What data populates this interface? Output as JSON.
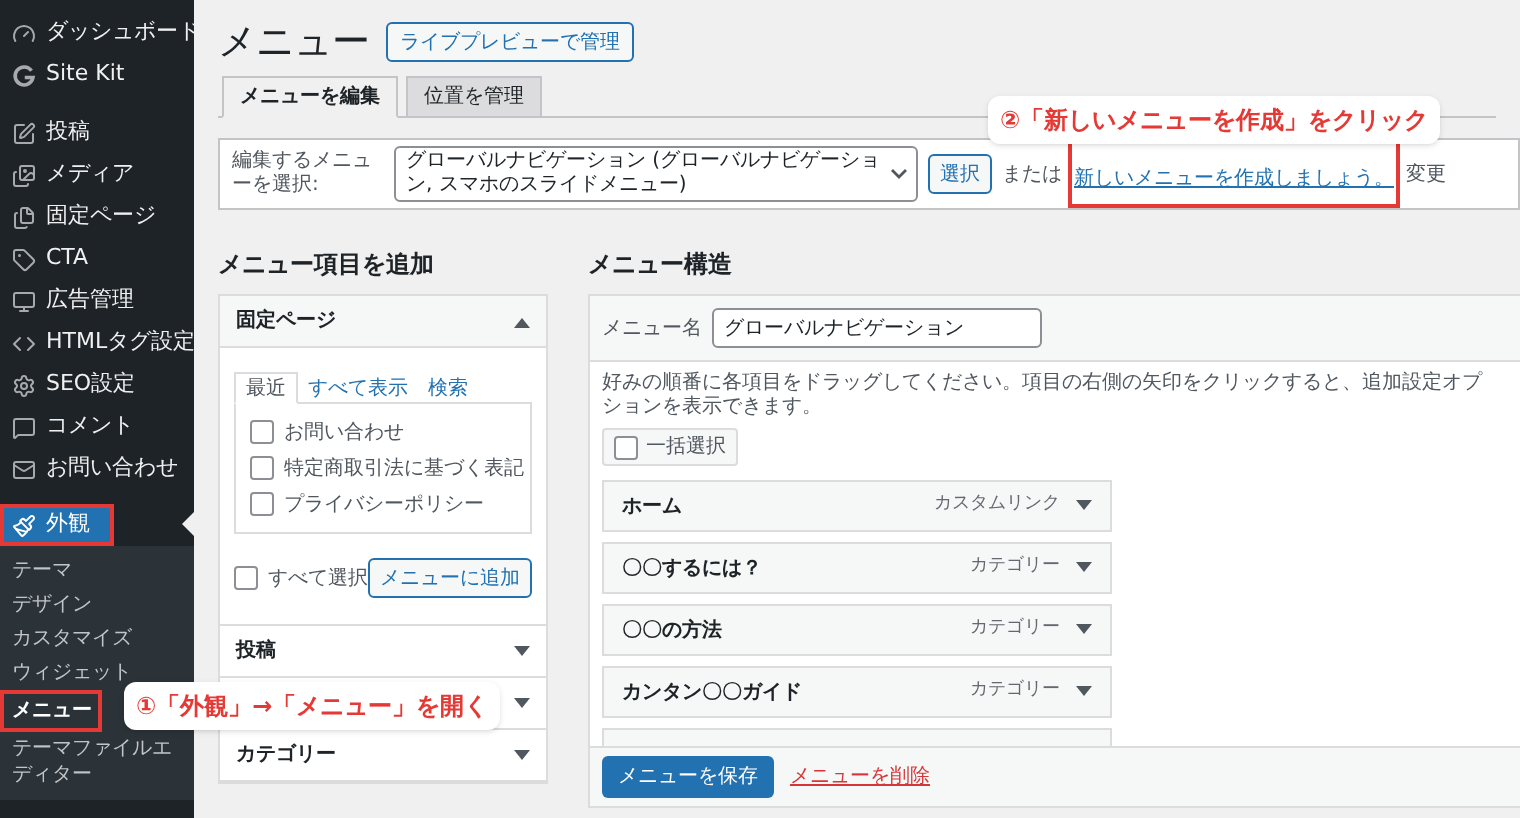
{
  "sidebar": {
    "items": [
      {
        "label": "ダッシュボード",
        "selected": false,
        "highlighted": false
      },
      {
        "label": "Site Kit",
        "selected": false,
        "highlighted": false
      },
      {
        "label": "投稿",
        "selected": false,
        "highlighted": false
      },
      {
        "label": "メディア",
        "selected": false,
        "highlighted": false
      },
      {
        "label": "固定ページ",
        "selected": false,
        "highlighted": false
      },
      {
        "label": "CTA",
        "selected": false,
        "highlighted": false
      },
      {
        "label": "広告管理",
        "selected": false,
        "highlighted": false
      },
      {
        "label": "HTMLタグ設定",
        "selected": false,
        "highlighted": false
      },
      {
        "label": "SEO設定",
        "selected": false,
        "highlighted": false
      },
      {
        "label": "コメント",
        "selected": false,
        "highlighted": false
      },
      {
        "label": "お問い合わせ",
        "selected": false,
        "highlighted": false
      },
      {
        "label": "外観",
        "selected": true,
        "highlighted": true,
        "children": [
          {
            "label": "テーマ",
            "selected": false,
            "highlighted": false
          },
          {
            "label": "デザイン",
            "selected": false,
            "highlighted": false
          },
          {
            "label": "カスタマイズ",
            "selected": false,
            "highlighted": false
          },
          {
            "label": "ウィジェット",
            "selected": false,
            "highlighted": false
          },
          {
            "label": "メニュー",
            "selected": true,
            "highlighted": true
          },
          {
            "label": "テーマファイルエディター",
            "selected": false,
            "highlighted": false
          }
        ]
      }
    ]
  },
  "page": {
    "title": "メニュー",
    "preview_button": "ライブプレビューで管理"
  },
  "tabs": [
    {
      "label": "メニューを編集",
      "selected": true
    },
    {
      "label": "位置を管理",
      "selected": false
    }
  ],
  "menu_select": {
    "label": "編集するメニューを選択:",
    "value": "グローバルナビゲーション (グローバルナビゲーション, スマホのスライドメニュー)",
    "button": "選択",
    "or_text": "または",
    "create_link": "新しいメニューを作成しましょう。",
    "create_link_highlighted": true,
    "trailing_text": "変更"
  },
  "add_items": {
    "heading": "メニュー項目を追加",
    "sections": [
      {
        "title": "固定ページ",
        "expanded": true,
        "tabs": [
          {
            "label": "最近",
            "selected": true
          },
          {
            "label": "すべて表示",
            "selected": false
          },
          {
            "label": "検索",
            "selected": false
          }
        ],
        "pages": [
          {
            "label": "お問い合わせ",
            "checked": false
          },
          {
            "label": "特定商取引法に基づく表記",
            "checked": false
          },
          {
            "label": "プライバシーポリシー",
            "checked": false
          }
        ],
        "select_all": {
          "label": "すべて選択",
          "checked": false
        },
        "add_button": "メニューに追加"
      },
      {
        "title": "投稿",
        "expanded": false
      },
      {
        "expanded": false
      },
      {
        "title": "カテゴリー",
        "expanded": false
      }
    ]
  },
  "structure": {
    "heading": "メニュー構造",
    "name_label": "メニュー名",
    "name_value": "グローバルナビゲーション",
    "instructions": "好みの順番に各項目をドラッグしてください。項目の右側の矢印をクリックすると、追加設定オプションを表示できます。",
    "bulk_select": {
      "label": "一括選択",
      "checked": false
    },
    "items": [
      {
        "title": "ホーム",
        "type": "カスタムリンク"
      },
      {
        "title": "〇〇するには？",
        "type": "カテゴリー"
      },
      {
        "title": "〇〇の方法",
        "type": "カテゴリー"
      },
      {
        "title": "カンタン〇〇ガイド",
        "type": "カテゴリー"
      }
    ],
    "save_button": "メニューを保存",
    "delete_link": "メニューを削除"
  },
  "annotations": [
    {
      "text": "①「外観」→「メニュー」を開く"
    },
    {
      "text": "②「新しいメニューを作成」をクリック"
    }
  ]
}
